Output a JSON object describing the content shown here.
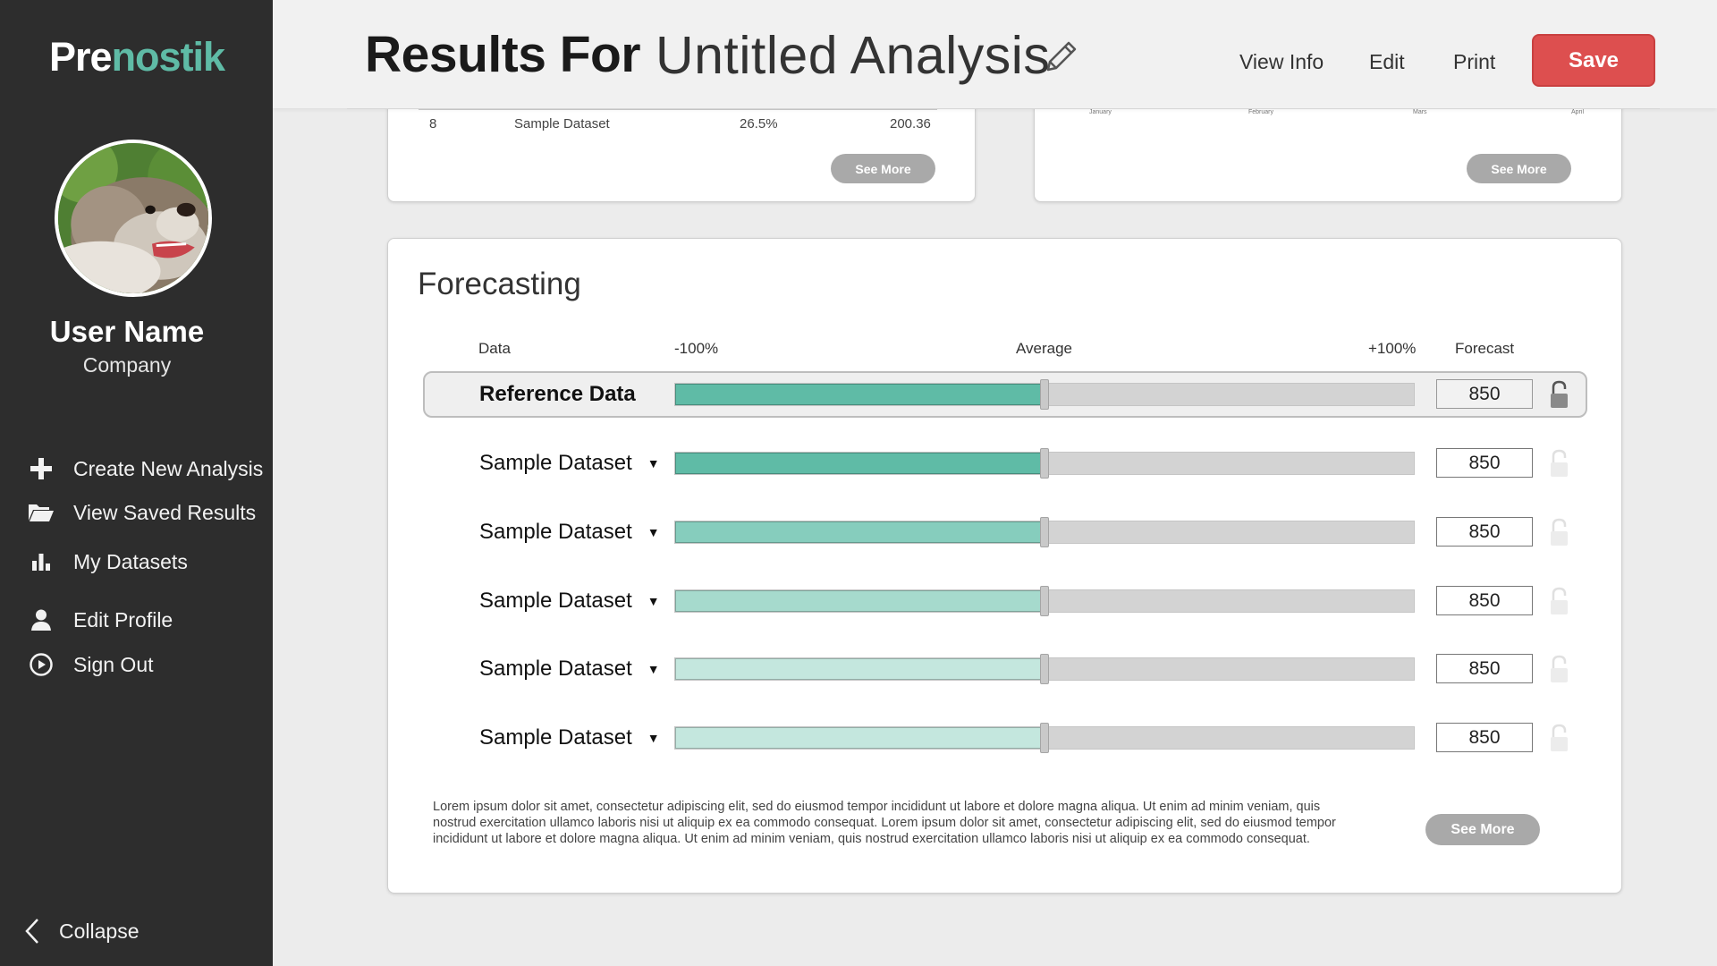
{
  "app": {
    "logo_part1": "Pre",
    "logo_part2": "nostik",
    "colors": {
      "brand": "#5fbba6",
      "save": "#dd4f4f",
      "sidebar_bg": "#2d2d2d"
    }
  },
  "user": {
    "name": "User Name",
    "company": "Company"
  },
  "nav": {
    "items": [
      {
        "label": "Create New Analysis",
        "icon": "plus-icon"
      },
      {
        "label": "View Saved Results",
        "icon": "folder-open-icon"
      },
      {
        "label": "My Datasets",
        "icon": "bar-chart-icon"
      },
      {
        "label": "Edit Profile",
        "icon": "user-icon"
      },
      {
        "label": "Sign Out",
        "icon": "power-icon"
      }
    ],
    "collapse": "Collapse"
  },
  "header": {
    "title_prefix": "Results For",
    "title_name": "Untitled Analysis",
    "links": [
      "View Info",
      "Edit",
      "Print"
    ],
    "save": "Save"
  },
  "top_cards": {
    "left": {
      "row": [
        "8",
        "Sample Dataset",
        "26.5%",
        "200.36"
      ],
      "see_more": "See More"
    },
    "right": {
      "months": [
        "January",
        "February",
        "Mars",
        "April"
      ],
      "see_more": "See More"
    }
  },
  "forecasting": {
    "title": "Forecasting",
    "columns": {
      "data": "Data",
      "min": "-100%",
      "avg": "Average",
      "max": "+100%",
      "forecast": "Forecast"
    },
    "rows": [
      {
        "label": "Reference Data",
        "value": "850",
        "percent": 0,
        "color": "#5fbba6",
        "locked": true
      },
      {
        "label": "Sample Dataset",
        "value": "850",
        "percent": 0,
        "color": "#5fbba6",
        "locked": false
      },
      {
        "label": "Sample Dataset",
        "value": "850",
        "percent": 0,
        "color": "#86cdbd",
        "locked": false
      },
      {
        "label": "Sample Dataset",
        "value": "850",
        "percent": 0,
        "color": "#a6dacd",
        "locked": false
      },
      {
        "label": "Sample Dataset",
        "value": "850",
        "percent": 0,
        "color": "#c4e7de",
        "locked": false
      },
      {
        "label": "Sample Dataset",
        "value": "850",
        "percent": 0,
        "color": "#c4e7de",
        "locked": false
      }
    ],
    "description": "Lorem ipsum dolor sit amet, consectetur adipiscing elit, sed do eiusmod tempor incididunt ut labore et dolore magna aliqua. Ut enim ad minim veniam, quis nostrud exercitation ullamco laboris nisi ut aliquip ex ea commodo consequat. Lorem ipsum dolor sit amet, consectetur adipiscing elit, sed do eiusmod tempor incididunt ut labore et dolore magna aliqua. Ut enim ad minim veniam, quis nostrud exercitation ullamco laboris nisi ut aliquip ex ea commodo consequat.",
    "see_more": "See More"
  }
}
